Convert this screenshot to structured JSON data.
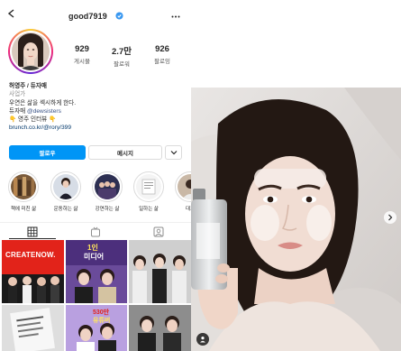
{
  "profile": {
    "username": "good7919",
    "icons": {
      "back": "chevron-left-icon",
      "verified": "verified-badge-icon",
      "more": "more-options-icon",
      "suggest": "chevron-down-icon"
    },
    "stats": [
      {
        "value": "929",
        "label": "게시물"
      },
      {
        "value": "2.7만",
        "label": "팔로워"
      },
      {
        "value": "926",
        "label": "팔로잉"
      }
    ],
    "bio": {
      "name": "허영주 / 듀자매",
      "category": "사업가",
      "line1": "우연은 삶을 섹시하게 한다.",
      "line2_prefix": "듀자매 ",
      "line2_mention": "@dewsisters",
      "line3": "👇 영주 인터뷰 👇",
      "link": "brunch.co.kr/@rory/399"
    },
    "buttons": {
      "follow": "팔로우",
      "message": "메시지"
    },
    "highlights": [
      {
        "label": "책에 미친 삶"
      },
      {
        "label": "운동하는 삶"
      },
      {
        "label": "강연하는 삶"
      },
      {
        "label": "일하는 삶"
      },
      {
        "label": "대표"
      }
    ],
    "tabs": [
      "grid-icon",
      "igtv-icon",
      "tagged-icon"
    ],
    "grid_texts": {
      "cell1": "CREATENOW.",
      "cell2_line1": "1인",
      "cell2_line2": "미디어",
      "cell5_line1": "530만",
      "cell5_line2": "유튜버"
    }
  },
  "post": {
    "bottom_icon": "tagged-user-icon",
    "next_icon": "chevron-right-icon"
  },
  "colors": {
    "follow_button": "#0095f6",
    "verified": "#3897f0",
    "grid_red": "#e2231a"
  }
}
